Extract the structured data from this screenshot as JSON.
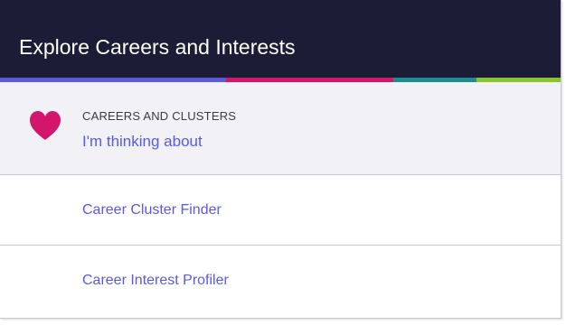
{
  "header": {
    "title": "Explore Careers and Interests"
  },
  "accent_colors": [
    "#5b5bd6",
    "#d8176b",
    "#1a8e91",
    "#8ac42c"
  ],
  "feature": {
    "icon": "heart-icon",
    "icon_color": "#d3166b",
    "eyebrow": "CAREERS AND CLUSTERS",
    "link": "I'm thinking about"
  },
  "links": [
    {
      "label": "Career Cluster Finder"
    },
    {
      "label": "Career Interest Profiler"
    }
  ],
  "colors": {
    "header_bg": "#1c1c37",
    "link": "#5a5adf",
    "feature_bg": "#f1f1f6"
  }
}
